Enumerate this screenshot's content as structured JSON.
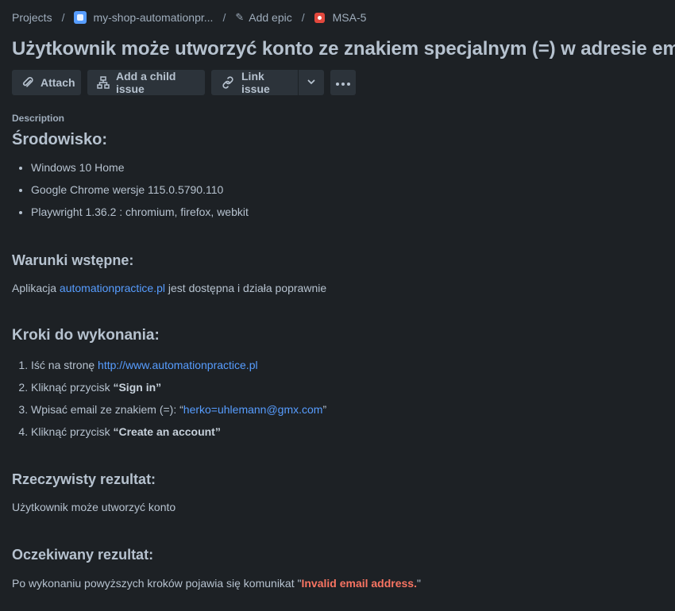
{
  "breadcrumb": {
    "projects": "Projects",
    "project": "my-shop-automationpr...",
    "epic": "Add epic",
    "issue_key": "MSA-5"
  },
  "title": "Użytkownik może utworzyć konto ze znakiem specjalnym (=) w adresie email",
  "toolbar": {
    "attach": "Attach",
    "child": "Add a child issue",
    "link": "Link issue"
  },
  "description_label": "Description",
  "env": {
    "heading": "Środowisko:",
    "items": [
      "Windows 10 Home",
      "Google Chrome wersje 115.0.5790.110",
      "Playwright 1.36.2 : chromium, firefox, webkit"
    ]
  },
  "pre": {
    "heading": "Warunki wstępne:",
    "prefix": "Aplikacja ",
    "link": "automationpractice.pl",
    "suffix": " jest dostępna i działa poprawnie"
  },
  "steps": {
    "heading": "Kroki do wykonania:",
    "s1_prefix": "Iść na stronę ",
    "s1_link": "http://www.automationpractice.pl",
    "s2_prefix": "Kliknąć przycisk ",
    "s2_bold": "“Sign in”",
    "s3_prefix": "Wpisać email ze znakiem (=): “",
    "s3_link": "herko=uhlemann@gmx.com",
    "s3_suffix": "”",
    "s4_prefix": "Kliknąć przycisk ",
    "s4_bold": "“Create an account”"
  },
  "actual": {
    "heading": "Rzeczywisty rezultat:",
    "text": "Użytkownik może utworzyć konto"
  },
  "expected": {
    "heading": "Oczekiwany rezultat:",
    "prefix": "Po wykonaniu powyższych kroków pojawia się komunikat \"",
    "red": "Invalid email address.",
    "suffix": "\""
  },
  "colors": {
    "background": "#1d2125",
    "text": "#b6c2cf",
    "link": "#579dff",
    "error": "#f87462",
    "button": "#2c333a"
  }
}
